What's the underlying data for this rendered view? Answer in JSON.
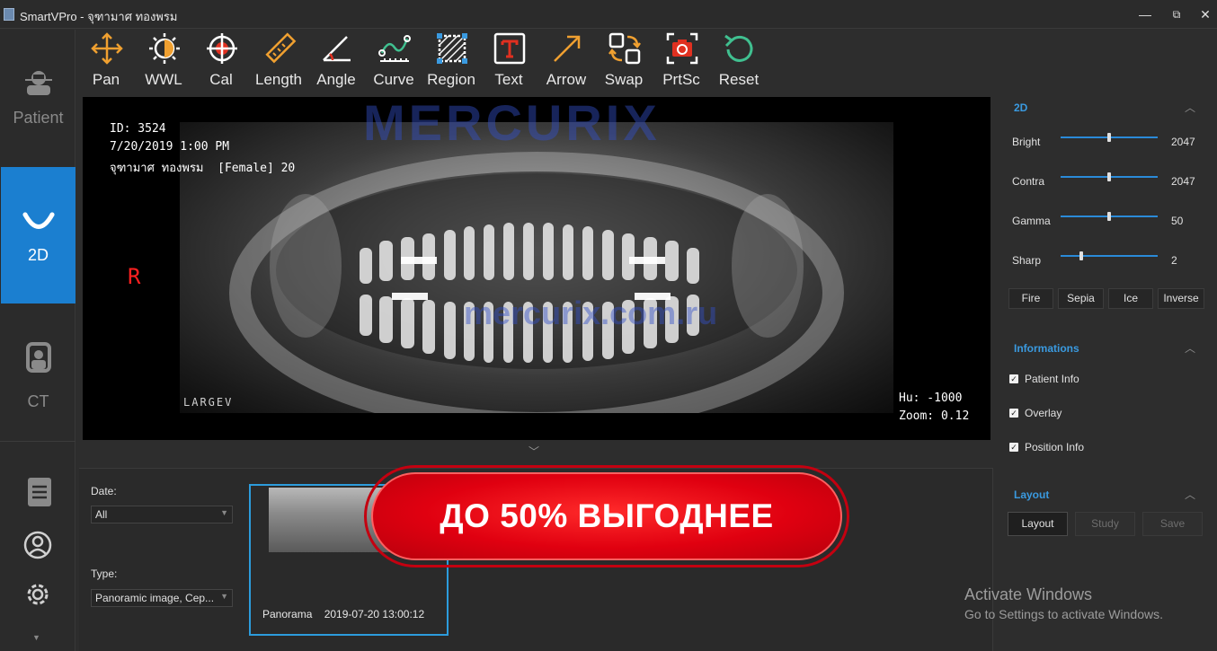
{
  "window": {
    "title": "SmartVPro - จุฑามาศ ทองพรม",
    "minimize": "—",
    "restore": "⧉",
    "close": "✕"
  },
  "nav": {
    "items": [
      {
        "label": "Patient",
        "icon": "patient-icon",
        "active": false
      },
      {
        "label": "2D",
        "icon": "dental-arch-icon",
        "active": true
      },
      {
        "label": "CT",
        "icon": "ct-scanner-icon",
        "active": false
      }
    ],
    "report_label_partial": "Report"
  },
  "toolbar": {
    "tools": [
      {
        "label": "Pan",
        "icon": "pan-icon"
      },
      {
        "label": "WWL",
        "icon": "wwl-icon"
      },
      {
        "label": "Cal",
        "icon": "calibrate-icon"
      },
      {
        "label": "Length",
        "icon": "ruler-icon"
      },
      {
        "label": "Angle",
        "icon": "angle-icon"
      },
      {
        "label": "Curve",
        "icon": "curve-icon"
      },
      {
        "label": "Region",
        "icon": "region-icon"
      },
      {
        "label": "Text",
        "icon": "text-icon"
      },
      {
        "label": "Arrow",
        "icon": "arrow-icon"
      },
      {
        "label": "Swap",
        "icon": "swap-icon"
      },
      {
        "label": "PrtSc",
        "icon": "screenshot-icon"
      },
      {
        "label": "Reset",
        "icon": "reset-icon"
      }
    ]
  },
  "viewer": {
    "patient_id": "ID: 3524",
    "datetime": "7/20/2019 1:00 PM",
    "patient_line": "จุฑามาศ ทองพรม  [Female] 20",
    "orientation": "R",
    "hu": "Hu: -1000",
    "zoom": "Zoom: 0.12",
    "brand_mark": "LARGEV",
    "watermark_logo": "MERCURIX",
    "watermark_url": "mercurix.com.ru"
  },
  "filters": {
    "date_label": "Date:",
    "date_value": "All",
    "type_label": "Type:",
    "type_value": "Panoramic image, Cep..."
  },
  "thumbnail": {
    "caption": "Panorama    2019-07-20 13:00:12"
  },
  "promo": {
    "text": "ДО 50% ВЫГОДНЕЕ"
  },
  "activate": {
    "line1": "Activate Windows",
    "line2": "Go to Settings to activate Windows."
  },
  "panel_2d": {
    "title": "2D",
    "sliders": [
      {
        "label": "Bright",
        "value": "2047",
        "fraction": 0.5
      },
      {
        "label": "Contra",
        "value": "2047",
        "fraction": 0.5
      },
      {
        "label": "Gamma",
        "value": "50",
        "fraction": 0.5
      },
      {
        "label": "Sharp",
        "value": "2",
        "fraction": 0.2
      }
    ],
    "filters": [
      "Fire",
      "Sepia",
      "Ice",
      "Inverse"
    ]
  },
  "panel_info": {
    "title": "Informations",
    "options": [
      {
        "label": "Patient Info",
        "checked": true
      },
      {
        "label": "Overlay",
        "checked": true
      },
      {
        "label": "Position Info",
        "checked": true
      }
    ]
  },
  "panel_layout": {
    "title": "Layout",
    "buttons": [
      "Layout",
      "Study",
      "Save"
    ]
  },
  "colors": {
    "accent": "#1b7fd0",
    "highlight": "#2c9cdc",
    "promo_red": "#e00010"
  }
}
